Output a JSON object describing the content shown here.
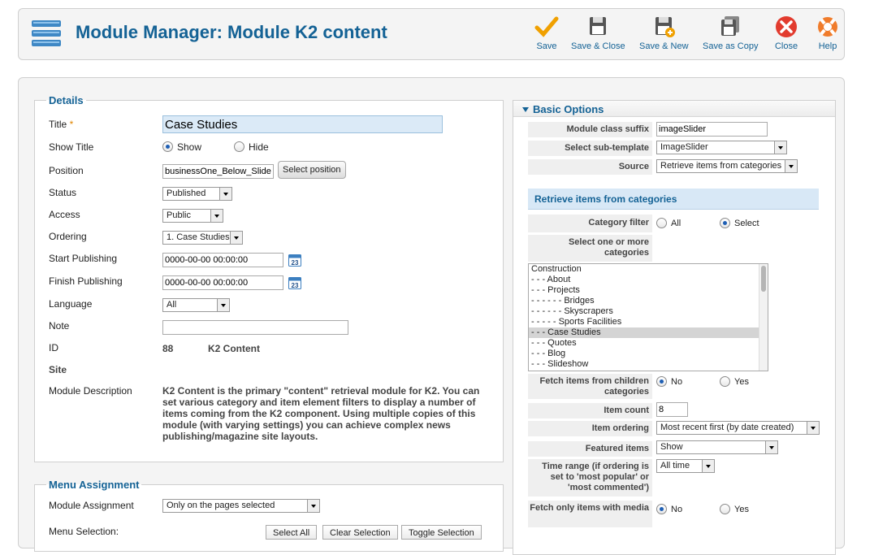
{
  "header": {
    "title": "Module Manager: Module K2 content"
  },
  "toolbar": {
    "save": "Save",
    "save_close": "Save & Close",
    "save_new": "Save & New",
    "save_copy": "Save as Copy",
    "close": "Close",
    "help": "Help"
  },
  "details": {
    "legend": "Details",
    "title_label": "Title",
    "required_mark": "*",
    "title_value": "Case Studies",
    "show_title_label": "Show Title",
    "show_title_options": [
      "Show",
      "Hide"
    ],
    "position_label": "Position",
    "position_value": "businessOne_Below_Slideshow",
    "select_position": "Select position",
    "status_label": "Status",
    "status_value": "Published",
    "access_label": "Access",
    "access_value": "Public",
    "ordering_label": "Ordering",
    "ordering_value": "1. Case Studies",
    "start_label": "Start Publishing",
    "start_value": "0000-00-00 00:00:00",
    "finish_label": "Finish Publishing",
    "finish_value": "0000-00-00 00:00:00",
    "calendar_day": "23",
    "language_label": "Language",
    "language_value": "All",
    "note_label": "Note",
    "note_value": "",
    "id_label": "ID",
    "id_value": "88",
    "module_type": "K2 Content",
    "site_label": "Site",
    "desc_label": "Module Description",
    "desc_value": "K2 Content is the primary \"content\" retrieval module for K2. You can set various category and item element filters to display a number of items coming from the K2 component. Using multiple copies of this module (with varying settings) you can achieve complex news publishing/magazine site layouts."
  },
  "menu_assignment": {
    "legend": "Menu Assignment",
    "assign_label": "Module Assignment",
    "assign_value": "Only on the pages selected",
    "selection_label": "Menu Selection:",
    "select_all": "Select All",
    "clear_selection": "Clear Selection",
    "toggle_selection": "Toggle Selection"
  },
  "basic_options": {
    "header": "Basic Options",
    "class_suffix_label": "Module class suffix",
    "class_suffix_value": "imageSlider",
    "subtemplate_label": "Select sub-template",
    "subtemplate_value": "ImageSlider",
    "source_label": "Source",
    "source_value": "Retrieve items from categories"
  },
  "retrieve": {
    "header": "Retrieve items from categories",
    "cat_filter_label": "Category filter",
    "cat_filter_options": [
      "All",
      "Select"
    ],
    "select_cats_label": "Select one or more categories",
    "categories": [
      "Construction",
      "- - - About",
      "- - - Projects",
      "- - - - - - Bridges",
      "- - - - - - Skyscrapers",
      "- - - - - Sports Facilities",
      "- - - Case Studies",
      "- - - Quotes",
      "- - - Blog",
      "- - - Slideshow"
    ],
    "fetch_children_label": "Fetch items from children categories",
    "yes_no": [
      "No",
      "Yes"
    ],
    "item_count_label": "Item count",
    "item_count_value": "8",
    "item_ordering_label": "Item ordering",
    "item_ordering_value": "Most recent first (by date created)",
    "featured_label": "Featured items",
    "featured_value": "Show",
    "time_range_label": "Time range (if ordering is set to 'most popular' or 'most commented')",
    "time_range_value": "All time",
    "media_label": "Fetch only items with media"
  },
  "colors": {
    "title_blue": "#146295",
    "save_orange": "#f0a000",
    "close_red": "#e23b2e",
    "help_orange": "#f07c2b"
  }
}
